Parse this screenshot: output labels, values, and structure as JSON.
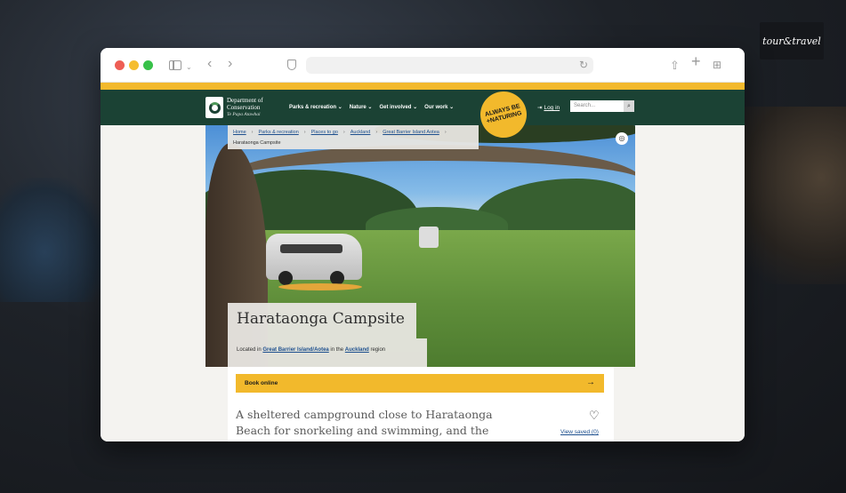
{
  "brand": {
    "logo_text": "tour&travel",
    "logo_sub": "..."
  },
  "browser": {
    "address": ""
  },
  "site": {
    "org_line1": "Department of",
    "org_line2": "Conservation",
    "org_line3": "Te Papa Atawhai",
    "nav": [
      "Parks & recreation",
      "Nature",
      "Get involved",
      "Our work"
    ],
    "badge": "ALWAYS BE +NATURING",
    "login": "Log in",
    "search_placeholder": "Search..."
  },
  "breadcrumb": {
    "items": [
      "Home",
      "Parks & recreation",
      "Places to go",
      "Auckland",
      "Great Barrier Island Aotea"
    ],
    "current": "Harataonga Campsite"
  },
  "page": {
    "title": "Harataonga Campsite",
    "location_prefix": "Located in",
    "location_island": "Great Barrier Island/Aotea",
    "location_mid": "in the",
    "location_region": "Auckland",
    "location_suffix": "region",
    "book_label": "Book online",
    "intro": "A sheltered campground close to Harataonga Beach for snorkeling and swimming, and the",
    "view_saved": "View saved (0)"
  }
}
